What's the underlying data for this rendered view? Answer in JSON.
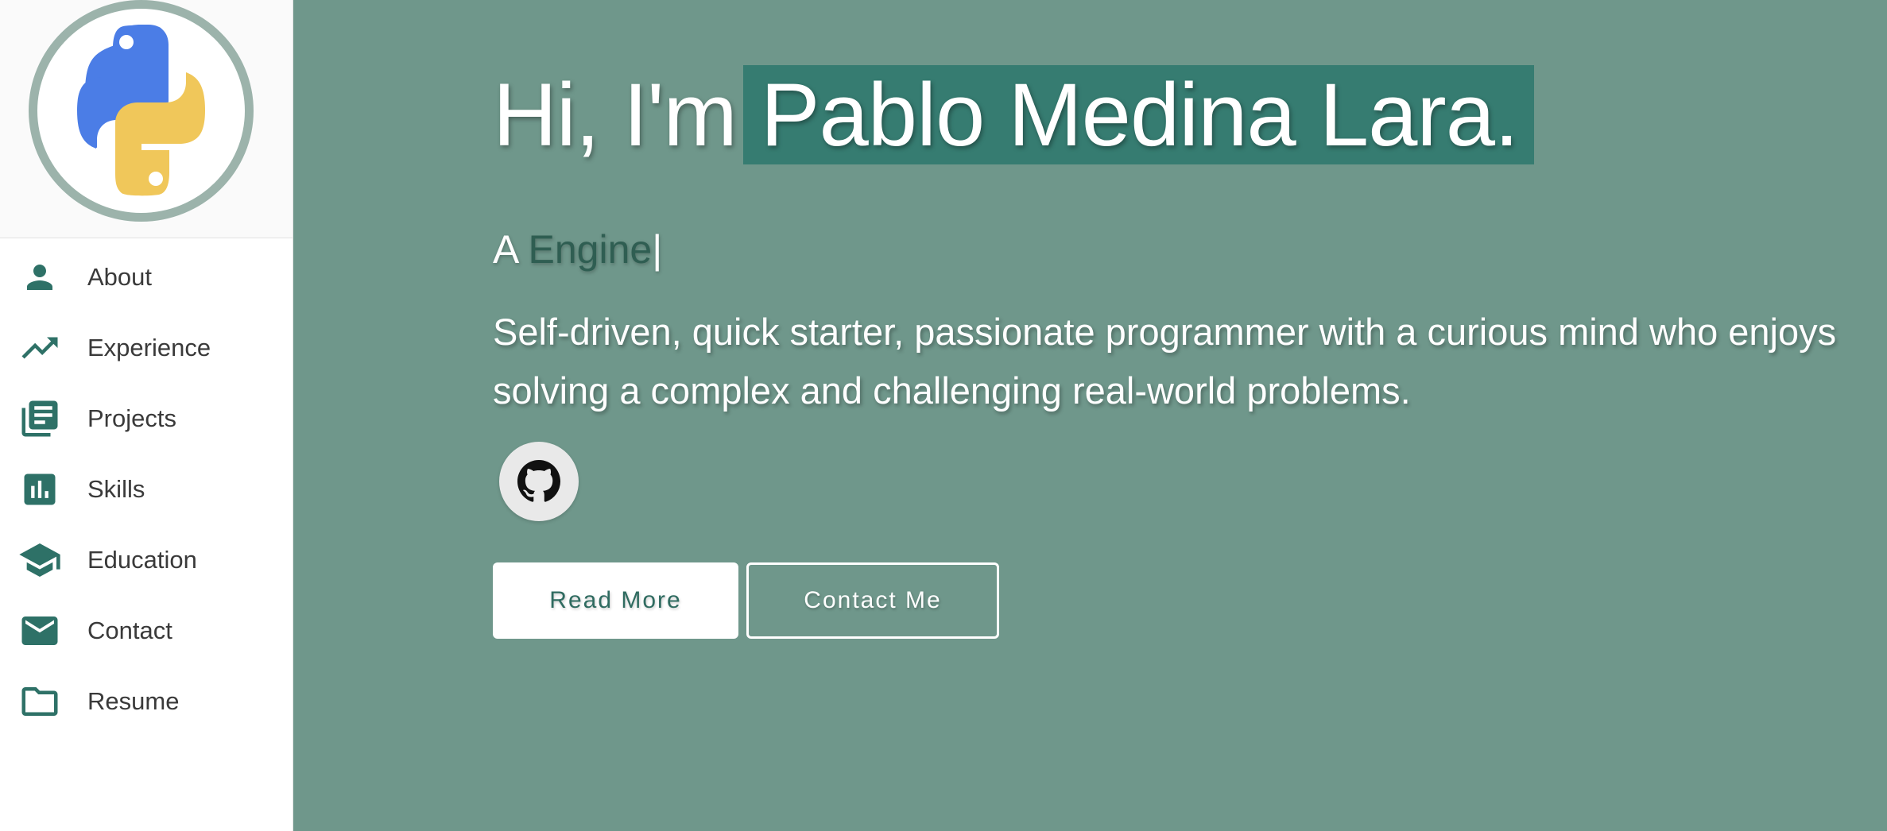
{
  "sidebar": {
    "logo": "python-logo",
    "items": [
      {
        "label": "About",
        "icon": "person-icon"
      },
      {
        "label": "Experience",
        "icon": "trending-up-icon"
      },
      {
        "label": "Projects",
        "icon": "library-books-icon"
      },
      {
        "label": "Skills",
        "icon": "bar-chart-icon"
      },
      {
        "label": "Education",
        "icon": "school-icon"
      },
      {
        "label": "Contact",
        "icon": "mail-icon"
      },
      {
        "label": "Resume",
        "icon": "folder-icon"
      }
    ]
  },
  "hero": {
    "greeting": "Hi, I'm",
    "name": "Pablo Medina Lara.",
    "subtitle_prefix": "A",
    "subtitle_role": "Engine",
    "cursor": "|",
    "description": "Self-driven, quick starter, passionate programmer with a curious mind who enjoys solving a complex and challenging real-world problems.",
    "social": {
      "icon": "github-icon"
    },
    "read_more_label": "Read More",
    "contact_label": "Contact Me"
  },
  "colors": {
    "primary": "#367c71",
    "background": "#6f978b",
    "icon": "#2e7167"
  }
}
